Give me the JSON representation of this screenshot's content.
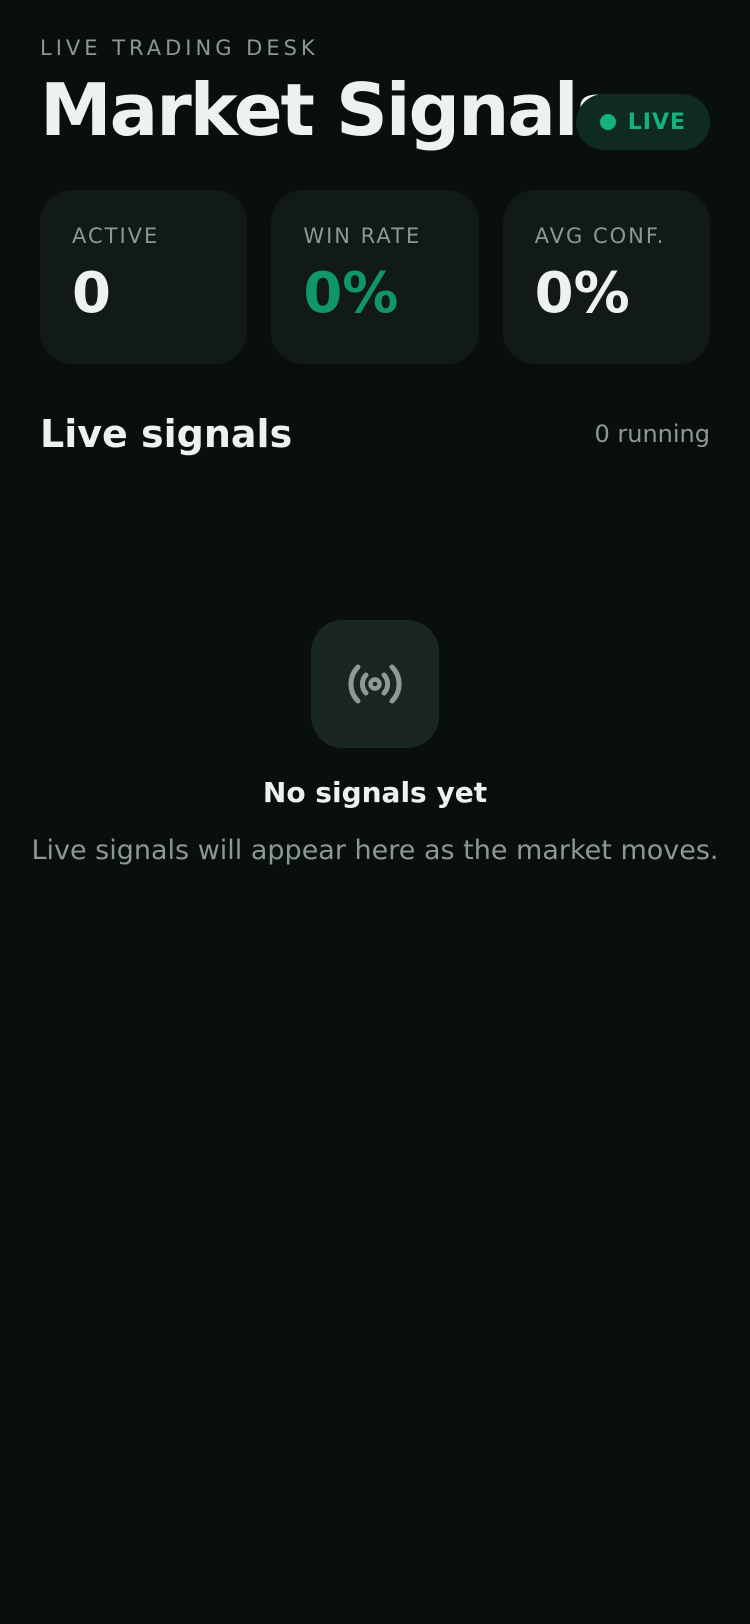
{
  "header": {
    "eyebrow": "LIVE TRADING DESK",
    "title": "Market Signals",
    "status_label": "LIVE",
    "status_color": "#14b37d"
  },
  "stats": [
    {
      "label": "ACTIVE",
      "value": "0"
    },
    {
      "label": "WIN RATE",
      "value": "0%",
      "accent_color": "#11966a"
    },
    {
      "label": "AVG CONF.",
      "value": "0%"
    }
  ],
  "signals_section": {
    "title": "Live signals",
    "count_text": "0 running"
  },
  "empty_state": {
    "icon": "broadcast-icon",
    "title": "No signals yet",
    "message": "Live signals will appear here as the market moves."
  }
}
